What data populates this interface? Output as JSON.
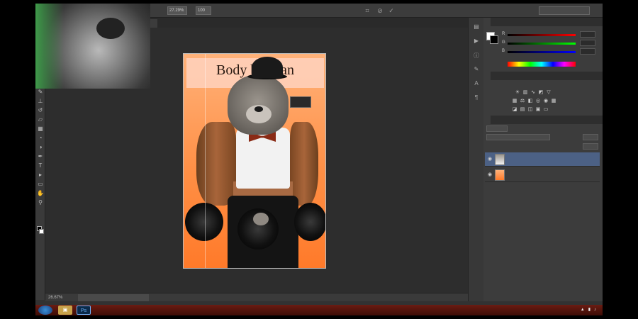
{
  "options": {
    "zoom_field": "27.29%",
    "angle_field": "100",
    "checkbox_label": "",
    "workspace": ""
  },
  "document": {
    "tab_label": "",
    "title": "Body by Man"
  },
  "transform_tip": {
    "line1": "",
    "line2": ""
  },
  "status": {
    "zoom": "26.67%",
    "doc_info": ""
  },
  "color_panel": {
    "tab_color": "",
    "tab_swatches": "",
    "r": "",
    "g": "",
    "b": ""
  },
  "adjust_panel": {
    "tab_adjustments": "",
    "tab_styles": "",
    "subtitle": ""
  },
  "layers_panel": {
    "tab_layers": "",
    "tab_channels": "",
    "tab_paths": "",
    "filter_label": "",
    "blend_mode": "",
    "opacity_label": "",
    "opacity_value": "",
    "fill_label": "",
    "fill_value": "",
    "layers": [
      {
        "name": ""
      },
      {
        "name": ""
      }
    ]
  },
  "taskbar": {
    "ps_label": "Ps",
    "clock": ""
  },
  "colors": {
    "accent": "#4c6185",
    "canvas_gradient_top": "#ffb27a",
    "canvas_gradient_bottom": "#ff7a2a",
    "taskbar": "#6a1c12"
  }
}
